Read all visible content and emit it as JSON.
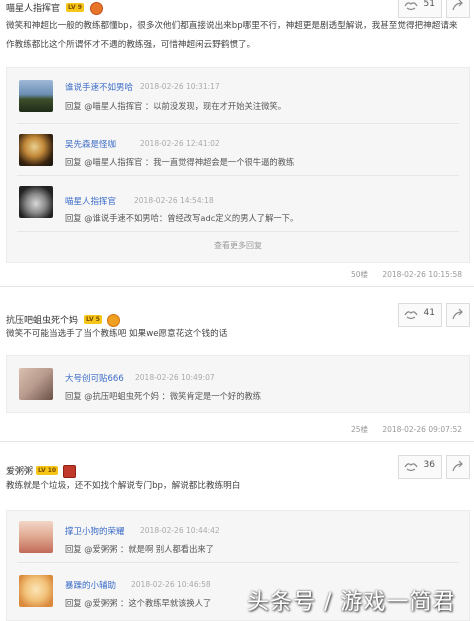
{
  "post1": {
    "body_lines": [
      "微笑和神超比一般的教练都懂bp，很多次他们都直接说出来bp哪里不行，神超更是剧透型解说，我甚至觉得把神超请来",
      "作教练都比这个所谓怀才不遇的教练强，可惜神超闲云野鹤惯了。"
    ],
    "likes": "51",
    "replies": [
      {
        "name": "谁说手速不如男哈",
        "time": "2018-02-26 10:31:17",
        "text": "回复 @喵星人指挥官 ：以前没发现，现在才开始关注微笑。"
      },
      {
        "name": "吴先森是怪咖",
        "time": "2018-02-26 12:41:02",
        "text": "回复 @喵星人指挥官 ：我一直觉得神超会是一个很牛逼的教练"
      },
      {
        "name": "喵星人指挥官",
        "time": "2018-02-26 14:54:18",
        "text": "回复 @谁说手速不如男哈：曾经改写adc定义的男人了解一下。"
      }
    ],
    "more_label": "查看更多回复",
    "floor": "50楼",
    "time": "2018-02-26 10:15:58"
  },
  "post2": {
    "user": "抗压吧蛆虫死个妈",
    "level": "LV 5",
    "body": "微笑不可能当选手了当个教练吧 如果we愿意花这个钱的话",
    "likes": "41",
    "replies": [
      {
        "name": "大号创可贴666",
        "time": "2018-02-26 10:49:07",
        "text": "回复 @抗压吧蛆虫死个妈 ：微笑肯定是一个好的教练"
      }
    ],
    "floor": "25楼",
    "time": "2018-02-26 09:07:52"
  },
  "post3": {
    "user": "爱粥粥",
    "level": "LV 10",
    "body": "教练就是个垃圾，还不如找个解说专门bp，解说都比教练明白",
    "likes": "36",
    "replies": [
      {
        "name": "撑卫小狗的荣耀",
        "time": "2018-02-26 10:44:42",
        "text": "回复 @爱粥粥 ：就是啊 别人都看出来了"
      },
      {
        "name": "暴躁的小辅助",
        "time": "2018-02-26 10:46:58",
        "text": "回复 @爱粥粥 ：这个教练早就该换人了"
      }
    ]
  },
  "watermark": "头条号 / 游戏一简君",
  "colors": {
    "link": "#3b6cc7",
    "level_badge": "#f5c518",
    "reply_bg": "#f6f6f6"
  }
}
